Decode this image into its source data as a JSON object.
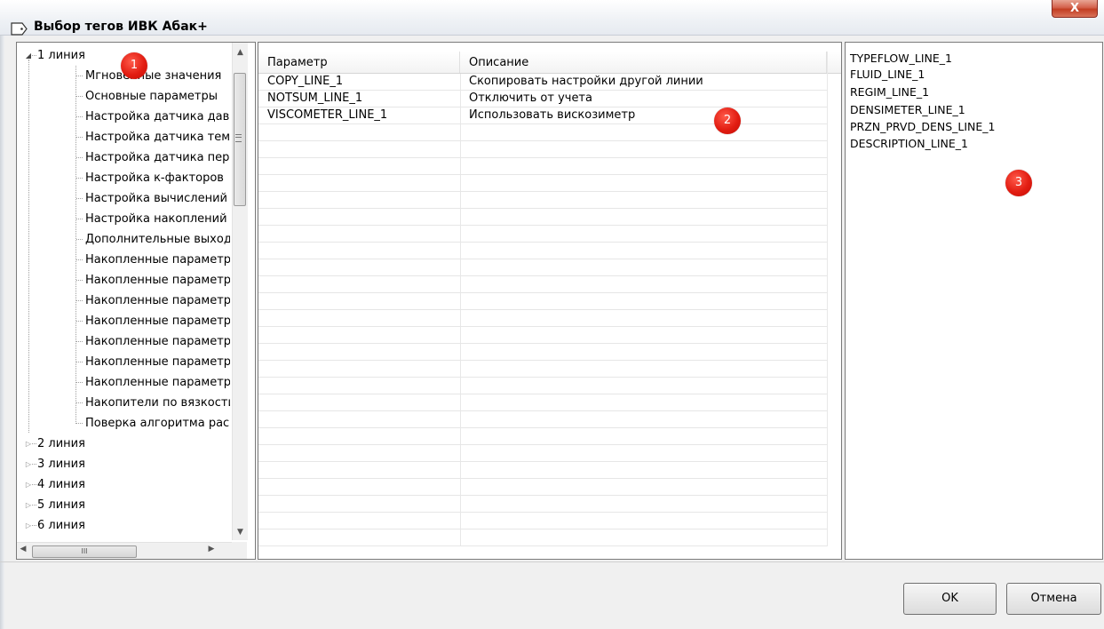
{
  "window": {
    "title": "Выбор тегов ИВК Абак+",
    "close_label": "X"
  },
  "tree": {
    "expanded_node": {
      "label": "1 линия",
      "expanded": true
    },
    "children": [
      "Мгновенные значения",
      "Основные параметры",
      "Настройка датчика дав",
      "Настройка датчика тем",
      "Настройка датчика пер",
      "Настройка к-факторов",
      "Настройка вычислений",
      "Настройка накоплений",
      "Дополнительные выход",
      "Накопленные параметр",
      "Накопленные параметр",
      "Накопленные параметр",
      "Накопленные параметр",
      "Накопленные параметр",
      "Накопленные параметр",
      "Накопленные параметр",
      "Накопители по вязкости",
      "Поверка алгоритма рас"
    ],
    "collapsed_nodes": [
      "2 линия",
      "3 линия",
      "4 линия",
      "5 линия",
      "6 линия"
    ],
    "hscroll_thumb_label": "III"
  },
  "table": {
    "columns": [
      "Параметр",
      "Описание"
    ],
    "rows": [
      {
        "param": "COPY_LINE_1",
        "desc": "Скопировать настройки другой линии"
      },
      {
        "param": "NOTSUM_LINE_1",
        "desc": "Отключить от учета"
      },
      {
        "param": "VISCOMETER_LINE_1",
        "desc": "Использовать вискозиметр"
      }
    ]
  },
  "selected_tags": [
    "TYPEFLOW_LINE_1",
    "FLUID_LINE_1",
    "REGIM_LINE_1",
    "DENSIMETER_LINE_1",
    "PRZN_PRVD_DENS_LINE_1",
    "DESCRIPTION_LINE_1"
  ],
  "badges": [
    "1",
    "2",
    "3"
  ],
  "buttons": {
    "ok": "OK",
    "cancel": "Отмена"
  },
  "colors": {
    "badge": "#e21d12",
    "close_button": "#c23d22"
  },
  "icons": {
    "title": "tag-icon",
    "tree_expanded": "triangle-expanded-icon",
    "tree_collapsed": "triangle-collapsed-icon"
  }
}
